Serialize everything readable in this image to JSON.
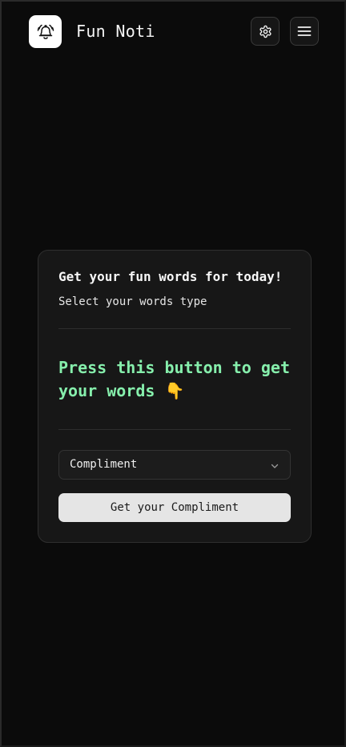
{
  "header": {
    "app_title": "Fun Noti",
    "logo_icon": "bell-alert-icon",
    "settings_icon": "gear-icon",
    "menu_icon": "hamburger-menu-icon"
  },
  "card": {
    "title": "Get your fun words for today!",
    "subtitle": "Select your words type",
    "message": "Press this button to get your words 👇",
    "select": {
      "selected": "Compliment",
      "icon": "chevron-down-icon"
    },
    "button_label": "Get your Compliment"
  },
  "colors": {
    "background": "#0b0b0b",
    "card": "#171717",
    "accent_green": "#86efac",
    "button": "#e5e5e5"
  }
}
